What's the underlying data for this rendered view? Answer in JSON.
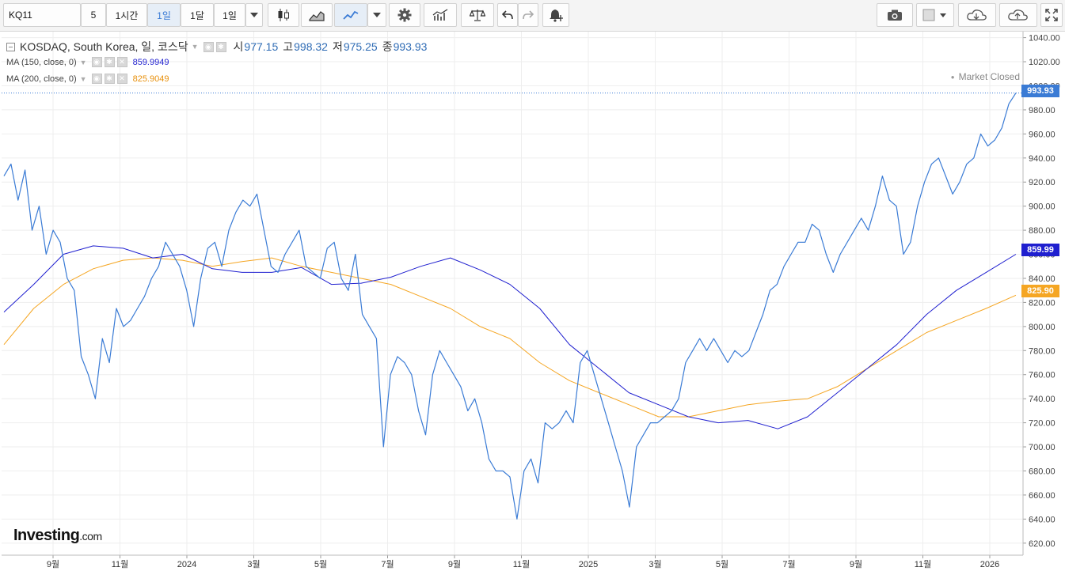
{
  "toolbar": {
    "symbol": "KQ11",
    "interval": "5",
    "btn_1h": "1시간",
    "btn_1d": "1일",
    "btn_1m": "1달",
    "btn_period": "1일"
  },
  "legend": {
    "title": "KOSDAQ, South Korea, 일, 코스닥",
    "open_label": "시",
    "open": "977.15",
    "high_label": "고",
    "high": "998.32",
    "low_label": "저",
    "low": "975.25",
    "close_label": "종",
    "close": "993.93",
    "ma150_label": "MA (150, close, 0)",
    "ma150_value": "859.9949",
    "ma200_label": "MA (200, close, 0)",
    "ma200_value": "825.9049"
  },
  "status": "Market Closed",
  "logo": {
    "brand": "Investing",
    "suffix": ".com"
  },
  "price_tags": {
    "last": "993.93",
    "ma150": "859.99",
    "ma200": "825.90"
  },
  "colors": {
    "price": "#3a7bd5",
    "ma150": "#1f1fcf",
    "ma200": "#f5a623",
    "grid": "#eeeeee",
    "active": "#3a7bd5"
  },
  "chart_data": {
    "type": "line",
    "ylim": [
      610,
      1045
    ],
    "y_ticks": [
      "1040.00",
      "1020.00",
      "1000.00",
      "980.00",
      "960.00",
      "940.00",
      "920.00",
      "900.00",
      "880.00",
      "860.00",
      "840.00",
      "820.00",
      "800.00",
      "780.00",
      "760.00",
      "740.00",
      "720.00",
      "700.00",
      "680.00",
      "660.00",
      "640.00",
      "620.00"
    ],
    "x_ticks": [
      "9월",
      "11월",
      "2024",
      "3월",
      "5월",
      "7월",
      "9월",
      "11월",
      "2025",
      "3월",
      "5월",
      "7월",
      "9월",
      "11월",
      "2026"
    ],
    "series": [
      {
        "name": "KOSDAQ",
        "values": [
          925,
          935,
          905,
          930,
          880,
          900,
          860,
          880,
          870,
          840,
          830,
          775,
          760,
          740,
          790,
          770,
          815,
          800,
          805,
          815,
          825,
          840,
          850,
          870,
          860,
          850,
          830,
          800,
          840,
          865,
          870,
          850,
          880,
          895,
          905,
          900,
          910,
          880,
          850,
          845,
          860,
          870,
          880,
          850,
          845,
          840,
          865,
          870,
          840,
          830,
          860,
          810,
          800,
          790,
          700,
          760,
          775,
          770,
          760,
          730,
          710,
          760,
          780,
          770,
          760,
          750,
          730,
          740,
          720,
          690,
          680,
          680,
          675,
          640,
          680,
          690,
          670,
          720,
          715,
          720,
          730,
          720,
          770,
          780,
          760,
          740,
          720,
          700,
          680,
          650,
          700,
          710,
          720,
          720,
          725,
          730,
          740,
          770,
          780,
          790,
          780,
          790,
          780,
          770,
          780,
          775,
          780,
          795,
          810,
          830,
          835,
          850,
          860,
          870,
          870,
          885,
          880,
          860,
          845,
          860,
          870,
          880,
          890,
          880,
          900,
          925,
          905,
          900,
          860,
          870,
          900,
          920,
          935,
          940,
          925,
          910,
          920,
          935,
          940,
          960,
          950,
          955,
          965,
          985,
          994
        ]
      },
      {
        "name": "MA (150, close, 0)",
        "values": [
          812,
          835,
          860,
          867,
          865,
          857,
          860,
          848,
          845,
          845,
          849,
          835,
          836,
          841,
          850,
          857,
          847,
          835,
          815,
          785,
          765,
          745,
          735,
          725,
          720,
          722,
          715,
          725,
          745,
          765,
          785,
          810,
          830,
          845,
          860
        ]
      },
      {
        "name": "MA (200, close, 0)",
        "values": [
          785,
          815,
          835,
          848,
          855,
          857,
          855,
          850,
          854,
          857,
          850,
          845,
          840,
          835,
          825,
          815,
          800,
          790,
          770,
          755,
          745,
          735,
          725,
          725,
          730,
          735,
          738,
          740,
          750,
          765,
          780,
          795,
          805,
          815,
          826
        ]
      }
    ]
  }
}
